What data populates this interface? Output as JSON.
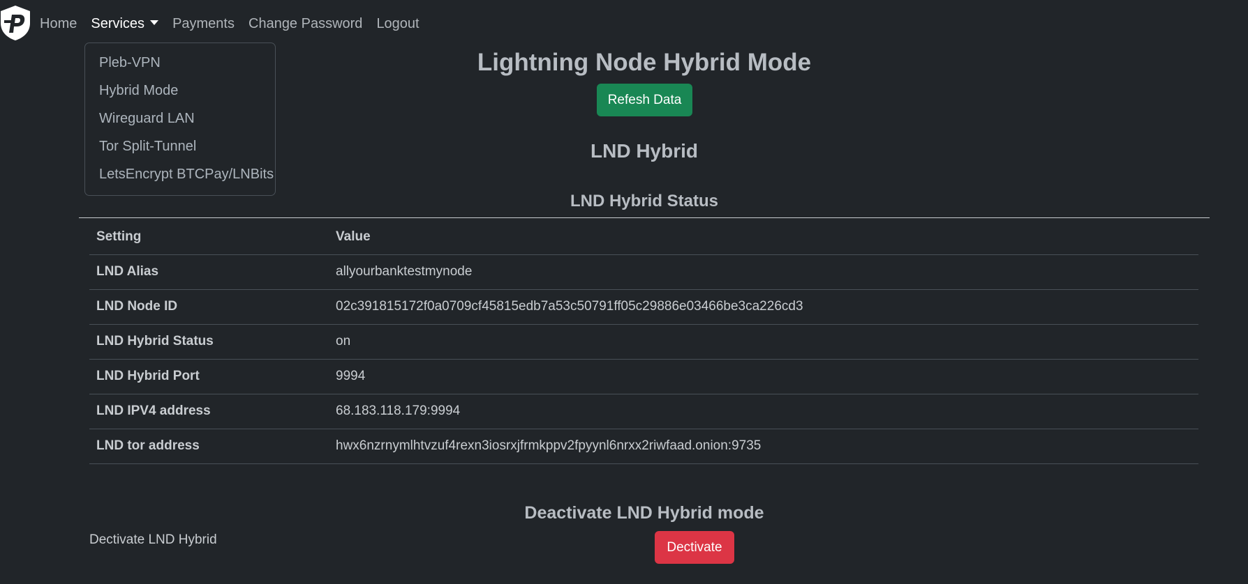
{
  "nav": {
    "items": [
      {
        "label": "Home"
      },
      {
        "label": "Services"
      },
      {
        "label": "Payments"
      },
      {
        "label": "Change Password"
      },
      {
        "label": "Logout"
      }
    ]
  },
  "services_menu": {
    "items": [
      {
        "label": "Pleb-VPN"
      },
      {
        "label": "Hybrid Mode"
      },
      {
        "label": "Wireguard LAN"
      },
      {
        "label": "Tor Split-Tunnel"
      },
      {
        "label": "LetsEncrypt BTCPay/LNBits"
      }
    ]
  },
  "page": {
    "title": "Lightning Node Hybrid Mode",
    "refresh_label": "Refesh Data",
    "section_title": "LND Hybrid",
    "status_title": "LND Hybrid Status"
  },
  "table": {
    "headers": [
      "Setting",
      "Value"
    ],
    "rows": [
      {
        "setting": "LND Alias",
        "value": "allyourbanktestmynode"
      },
      {
        "setting": "LND Node ID",
        "value": "02c391815172f0a0709cf45815edb7a53c50791ff05c29886e03466be3ca226cd3"
      },
      {
        "setting": "LND Hybrid Status",
        "value": "on"
      },
      {
        "setting": "LND Hybrid Port",
        "value": "9994"
      },
      {
        "setting": "LND IPV4 address",
        "value": "68.183.118.179:9994"
      },
      {
        "setting": "LND tor address",
        "value": "hwx6nzrnymlhtvzuf4rexn3iosrxjfrmkppv2fpyynl6nrxx2riwfaad.onion:9735"
      }
    ]
  },
  "deactivate": {
    "title": "Deactivate LND Hybrid mode",
    "label": "Dectivate LND Hybrid",
    "button_label": "Dectivate"
  },
  "colors": {
    "background": "#212529",
    "success": "#198754",
    "danger": "#dc3545"
  }
}
